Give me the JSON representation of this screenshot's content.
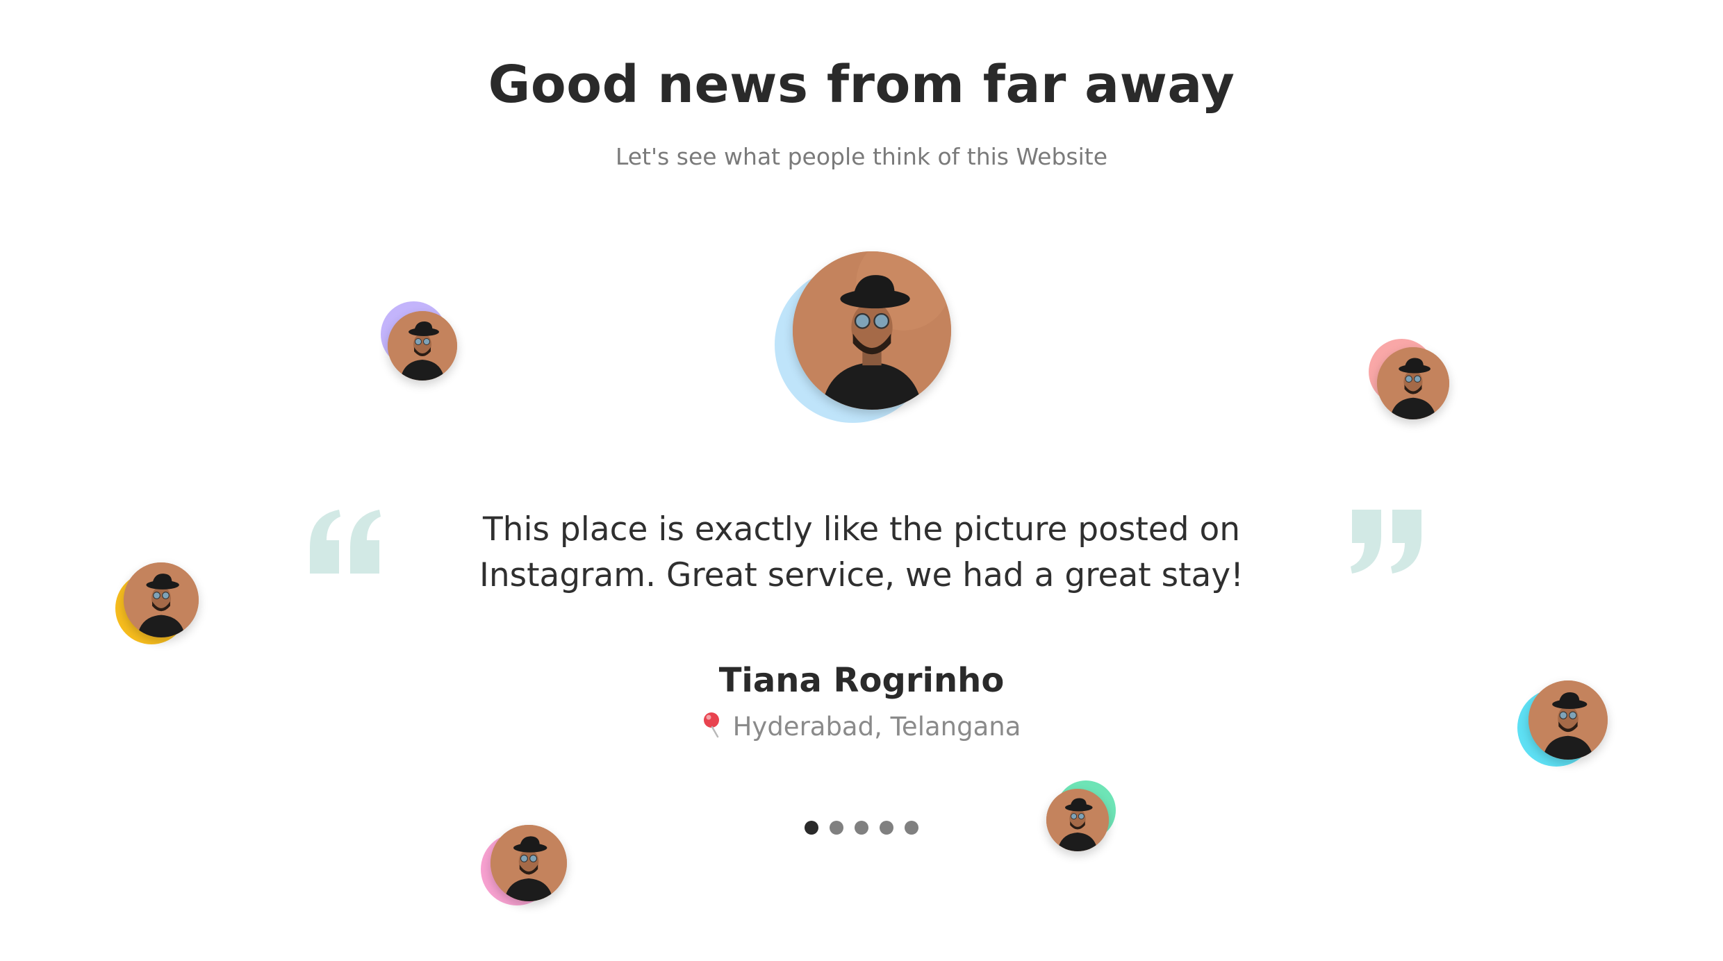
{
  "header": {
    "title": "Good news from far away",
    "subtitle": "Let's see what people think of this Website"
  },
  "testimonial": {
    "quote": "This place is exactly like the picture posted on Instagram. Great service, we had a great stay!",
    "name": "Tiana Rogrinho",
    "location": "Hyderabad, Telangana",
    "location_icon": "pin-icon",
    "quote_color": "#d2e9e5"
  },
  "carousel": {
    "total": 5,
    "active_index": 0,
    "active_color": "#2a2a2a",
    "inactive_color": "#808080"
  },
  "avatars": [
    {
      "id": "main",
      "ring_color": "#bfe4fa"
    },
    {
      "id": "top-left",
      "ring_color": "#c3b4fb"
    },
    {
      "id": "top-right",
      "ring_color": "#f9a7a7"
    },
    {
      "id": "mid-left",
      "ring_color": "#f7bd1e"
    },
    {
      "id": "mid-right",
      "ring_color": "#5ee0f4"
    },
    {
      "id": "bottom-left",
      "ring_color": "#f7a1d0"
    },
    {
      "id": "bottom-center",
      "ring_color": "#6ee4b6"
    }
  ]
}
